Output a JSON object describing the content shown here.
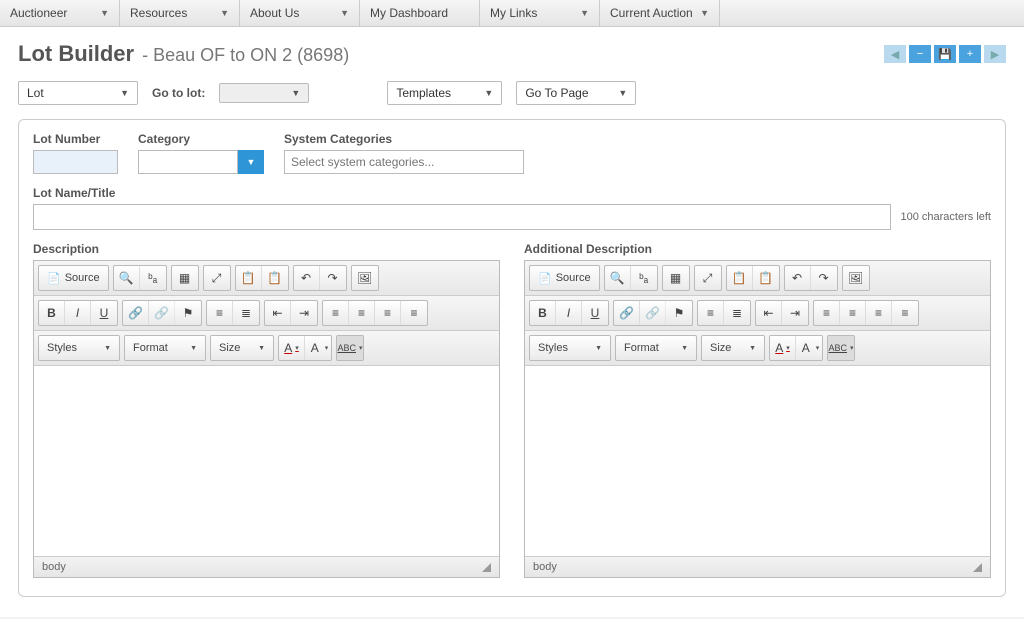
{
  "nav": [
    {
      "label": "Auctioneer",
      "dropdown": true
    },
    {
      "label": "Resources",
      "dropdown": true
    },
    {
      "label": "About Us",
      "dropdown": true
    },
    {
      "label": "My Dashboard",
      "dropdown": false
    },
    {
      "label": "My Links",
      "dropdown": true
    },
    {
      "label": "Current Auction",
      "dropdown": true
    }
  ],
  "page_title": "Lot Builder",
  "page_subtitle": "- Beau OF to ON 2 (8698)",
  "lot_select": "Lot",
  "go_to_lot_label": "Go to lot:",
  "templates_label": "Templates",
  "go_to_page_label": "Go To Page",
  "form": {
    "lot_number_label": "Lot Number",
    "lot_number_value": "",
    "category_label": "Category",
    "category_value": "",
    "system_categories_label": "System Categories",
    "system_categories_placeholder": "Select system categories...",
    "lot_name_label": "Lot Name/Title",
    "lot_name_value": "",
    "chars_left": "100 characters left",
    "description_label": "Description",
    "additional_description_label": "Additional Description"
  },
  "editor": {
    "source": "Source",
    "styles": "Styles",
    "format": "Format",
    "size": "Size",
    "status": "body",
    "abc": "ABC"
  }
}
